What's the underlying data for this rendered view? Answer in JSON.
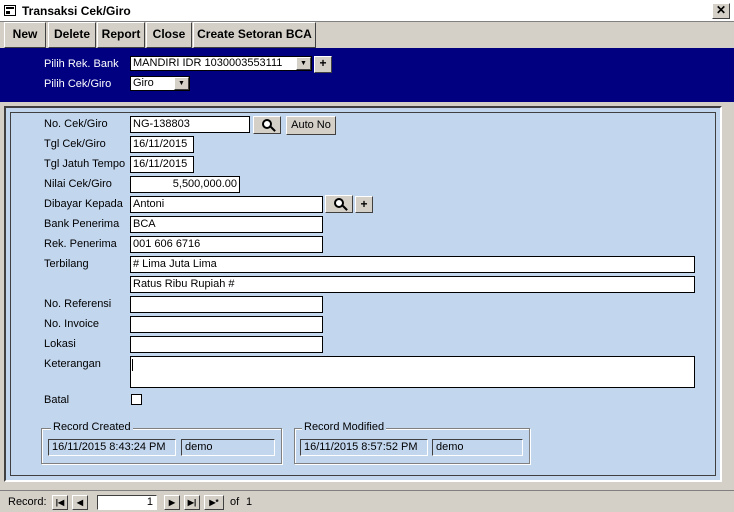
{
  "window": {
    "title": "Transaksi Cek/Giro",
    "close_glyph": "✕"
  },
  "toolbar": {
    "buttons": [
      {
        "label": "New"
      },
      {
        "label": "Delete"
      },
      {
        "label": "Report"
      },
      {
        "label": "Close"
      },
      {
        "label": "Create Setoran BCA"
      }
    ]
  },
  "header": {
    "bank_label": "Pilih Rek. Bank",
    "bank_value": "MANDIRI IDR  1030003553111",
    "type_label": "Pilih Cek/Giro",
    "type_value": "Giro",
    "add_glyph": "+"
  },
  "form": {
    "no_cek_label": "No. Cek/Giro",
    "no_cek_value": "NG-138803",
    "auto_no_label": "Auto No",
    "tgl_cek_label": "Tgl Cek/Giro",
    "tgl_cek_value": "16/11/2015",
    "tgl_jatuh_label": "Tgl Jatuh Tempo",
    "tgl_jatuh_value": "16/11/2015",
    "nilai_label": "Nilai Cek/Giro",
    "nilai_value": "5,500,000.00",
    "dibayar_label": "Dibayar Kepada",
    "dibayar_value": "Antoni",
    "add_glyph": "+",
    "bank_penerima_label": "Bank Penerima",
    "bank_penerima_value": "BCA",
    "rek_penerima_label": "Rek. Penerima",
    "rek_penerima_value": "001 606 6716",
    "terbilang_label": "Terbilang",
    "terbilang_line1": "# Lima Juta Lima",
    "terbilang_line2": "Ratus  Ribu Rupiah #",
    "no_referensi_label": "No. Referensi",
    "no_referensi_value": "",
    "no_invoice_label": "No. Invoice",
    "no_invoice_value": "",
    "lokasi_label": "Lokasi",
    "lokasi_value": "",
    "keterangan_label": "Keterangan",
    "keterangan_value": "",
    "batal_label": "Batal",
    "batal_checked": false
  },
  "record_created": {
    "title": "Record Created",
    "datetime": "16/11/2015 8:43:24 PM",
    "user": "demo"
  },
  "record_modified": {
    "title": "Record Modified",
    "datetime": "16/11/2015 8:57:52 PM",
    "user": "demo"
  },
  "navigation": {
    "record_label": "Record:",
    "current": "1",
    "of_label": "of",
    "total": "1"
  }
}
